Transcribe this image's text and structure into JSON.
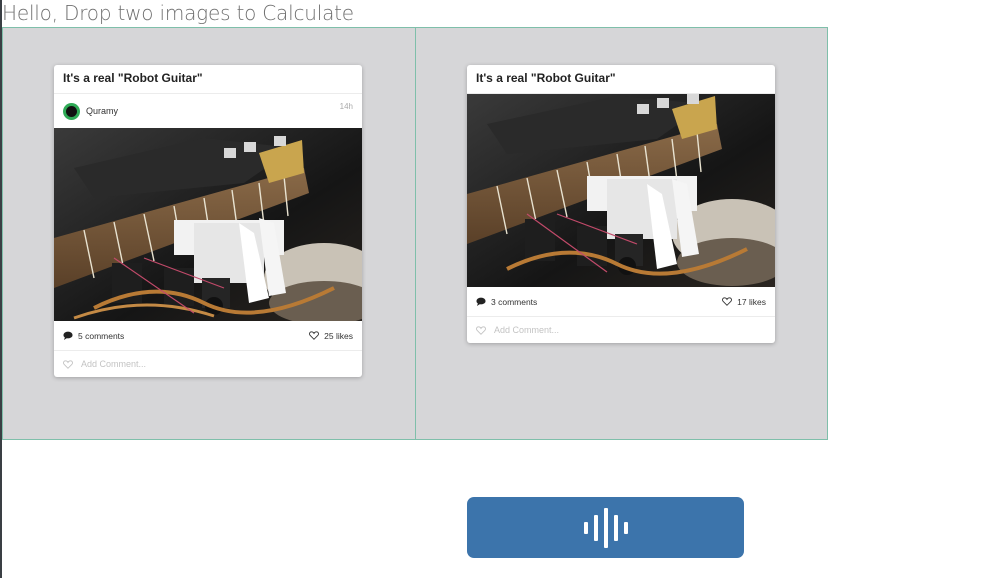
{
  "page": {
    "title": "Hello, Drop two images to Calculate"
  },
  "cards": [
    {
      "title": "It's a real \"Robot Guitar\"",
      "author": "Quramy",
      "time": "14h",
      "comments": "5 comments",
      "likes": "25 likes",
      "add_comment_placeholder": "Add Comment..."
    },
    {
      "title": "It's a real \"Robot Guitar\"",
      "comments": "3 comments",
      "likes": "17 likes",
      "add_comment_placeholder": "Add Comment..."
    }
  ],
  "icons": {
    "comment": "comment-icon",
    "heart": "heart-icon",
    "avatar": "avatar-icon",
    "voice": "voice-wave-icon"
  },
  "colors": {
    "drop_zone_bg": "#d6d6d8",
    "drop_zone_border": "#7fbfaa",
    "button_bg": "#3c74ab",
    "avatar_green": "#2faa56"
  }
}
